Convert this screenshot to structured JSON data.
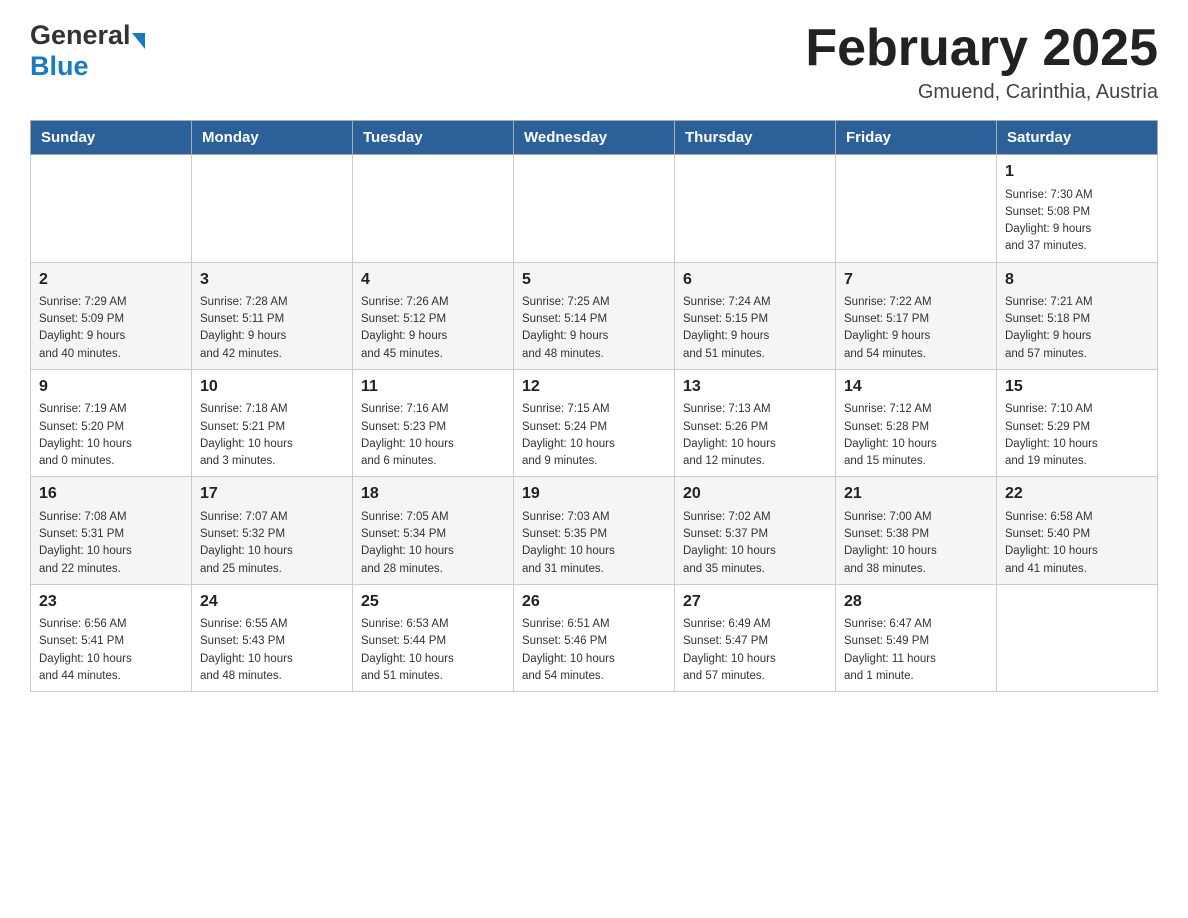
{
  "logo": {
    "general": "General",
    "blue": "Blue"
  },
  "title": "February 2025",
  "subtitle": "Gmuend, Carinthia, Austria",
  "weekdays": [
    "Sunday",
    "Monday",
    "Tuesday",
    "Wednesday",
    "Thursday",
    "Friday",
    "Saturday"
  ],
  "weeks": [
    [
      {
        "day": "",
        "info": ""
      },
      {
        "day": "",
        "info": ""
      },
      {
        "day": "",
        "info": ""
      },
      {
        "day": "",
        "info": ""
      },
      {
        "day": "",
        "info": ""
      },
      {
        "day": "",
        "info": ""
      },
      {
        "day": "1",
        "info": "Sunrise: 7:30 AM\nSunset: 5:08 PM\nDaylight: 9 hours\nand 37 minutes."
      }
    ],
    [
      {
        "day": "2",
        "info": "Sunrise: 7:29 AM\nSunset: 5:09 PM\nDaylight: 9 hours\nand 40 minutes."
      },
      {
        "day": "3",
        "info": "Sunrise: 7:28 AM\nSunset: 5:11 PM\nDaylight: 9 hours\nand 42 minutes."
      },
      {
        "day": "4",
        "info": "Sunrise: 7:26 AM\nSunset: 5:12 PM\nDaylight: 9 hours\nand 45 minutes."
      },
      {
        "day": "5",
        "info": "Sunrise: 7:25 AM\nSunset: 5:14 PM\nDaylight: 9 hours\nand 48 minutes."
      },
      {
        "day": "6",
        "info": "Sunrise: 7:24 AM\nSunset: 5:15 PM\nDaylight: 9 hours\nand 51 minutes."
      },
      {
        "day": "7",
        "info": "Sunrise: 7:22 AM\nSunset: 5:17 PM\nDaylight: 9 hours\nand 54 minutes."
      },
      {
        "day": "8",
        "info": "Sunrise: 7:21 AM\nSunset: 5:18 PM\nDaylight: 9 hours\nand 57 minutes."
      }
    ],
    [
      {
        "day": "9",
        "info": "Sunrise: 7:19 AM\nSunset: 5:20 PM\nDaylight: 10 hours\nand 0 minutes."
      },
      {
        "day": "10",
        "info": "Sunrise: 7:18 AM\nSunset: 5:21 PM\nDaylight: 10 hours\nand 3 minutes."
      },
      {
        "day": "11",
        "info": "Sunrise: 7:16 AM\nSunset: 5:23 PM\nDaylight: 10 hours\nand 6 minutes."
      },
      {
        "day": "12",
        "info": "Sunrise: 7:15 AM\nSunset: 5:24 PM\nDaylight: 10 hours\nand 9 minutes."
      },
      {
        "day": "13",
        "info": "Sunrise: 7:13 AM\nSunset: 5:26 PM\nDaylight: 10 hours\nand 12 minutes."
      },
      {
        "day": "14",
        "info": "Sunrise: 7:12 AM\nSunset: 5:28 PM\nDaylight: 10 hours\nand 15 minutes."
      },
      {
        "day": "15",
        "info": "Sunrise: 7:10 AM\nSunset: 5:29 PM\nDaylight: 10 hours\nand 19 minutes."
      }
    ],
    [
      {
        "day": "16",
        "info": "Sunrise: 7:08 AM\nSunset: 5:31 PM\nDaylight: 10 hours\nand 22 minutes."
      },
      {
        "day": "17",
        "info": "Sunrise: 7:07 AM\nSunset: 5:32 PM\nDaylight: 10 hours\nand 25 minutes."
      },
      {
        "day": "18",
        "info": "Sunrise: 7:05 AM\nSunset: 5:34 PM\nDaylight: 10 hours\nand 28 minutes."
      },
      {
        "day": "19",
        "info": "Sunrise: 7:03 AM\nSunset: 5:35 PM\nDaylight: 10 hours\nand 31 minutes."
      },
      {
        "day": "20",
        "info": "Sunrise: 7:02 AM\nSunset: 5:37 PM\nDaylight: 10 hours\nand 35 minutes."
      },
      {
        "day": "21",
        "info": "Sunrise: 7:00 AM\nSunset: 5:38 PM\nDaylight: 10 hours\nand 38 minutes."
      },
      {
        "day": "22",
        "info": "Sunrise: 6:58 AM\nSunset: 5:40 PM\nDaylight: 10 hours\nand 41 minutes."
      }
    ],
    [
      {
        "day": "23",
        "info": "Sunrise: 6:56 AM\nSunset: 5:41 PM\nDaylight: 10 hours\nand 44 minutes."
      },
      {
        "day": "24",
        "info": "Sunrise: 6:55 AM\nSunset: 5:43 PM\nDaylight: 10 hours\nand 48 minutes."
      },
      {
        "day": "25",
        "info": "Sunrise: 6:53 AM\nSunset: 5:44 PM\nDaylight: 10 hours\nand 51 minutes."
      },
      {
        "day": "26",
        "info": "Sunrise: 6:51 AM\nSunset: 5:46 PM\nDaylight: 10 hours\nand 54 minutes."
      },
      {
        "day": "27",
        "info": "Sunrise: 6:49 AM\nSunset: 5:47 PM\nDaylight: 10 hours\nand 57 minutes."
      },
      {
        "day": "28",
        "info": "Sunrise: 6:47 AM\nSunset: 5:49 PM\nDaylight: 11 hours\nand 1 minute."
      },
      {
        "day": "",
        "info": ""
      }
    ]
  ]
}
